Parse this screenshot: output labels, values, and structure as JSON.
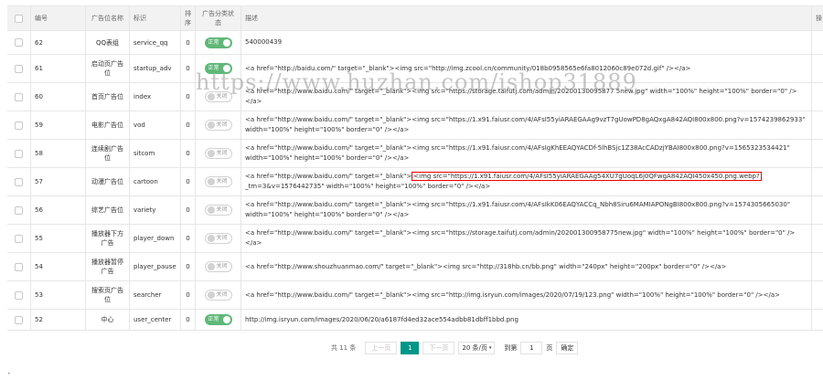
{
  "table": {
    "headers": {
      "id": "编号",
      "name": "广告位名称",
      "ident": "标识",
      "sort": "排序",
      "status": "广告分类状态",
      "desc": "描述",
      "last": "操"
    },
    "rows": [
      {
        "id": "62",
        "name": "QQ表组",
        "ident": "service_qq",
        "sort": "0",
        "status": "on",
        "status_label": "正常",
        "desc": "540000439"
      },
      {
        "id": "61",
        "name": "启动页广告位",
        "ident": "startup_adv",
        "sort": "0",
        "status": "on",
        "status_label": "正常",
        "desc": "<a href=\"http://baidu.com/\" target=\"_blank\"><img src=\"http://img.zcool.cn/community/018b0958565e6fa8012060c89e072d.gif\" /></a>"
      },
      {
        "id": "60",
        "name": "首页广告位",
        "ident": "index",
        "sort": "0",
        "status": "off",
        "status_label": "关闭",
        "desc": "<a href=\"http://www.baidu.com/\" target=\"_blank\"><img src=\"https://storage.taifutj.com/admin/20200130095877 5new.jpg\" width=\"100%\" height=\"100%\" border=\"0\" /></a>"
      },
      {
        "id": "59",
        "name": "电影广告位",
        "ident": "vod",
        "sort": "0",
        "status": "off",
        "status_label": "关闭",
        "desc": "<a href=\"http://www.baidu.com/\" target=\"_blank\"><img src=\"https://1.x91.faiusr.com/4/AFsI55yiARAEGAAg9vzT7gUowPD8gAQxgA842AQI800x800.png?v=1574239862933\" width=\"100%\" height=\"100%\" border=\"0\" /></a>"
      },
      {
        "id": "58",
        "name": "连续剧广告位",
        "ident": "sitcom",
        "sort": "0",
        "status": "off",
        "status_label": "关闭",
        "desc": "<a href=\"http://www.baidu.com/\" target=\"_blank\"><img src=\"https://1.x91.faiusr.com/4/AFsIgKhEEAQYACDf-5lhBSjc1Z38AcCADzjYBAI800x800.png?v=1565323534421\" width=\"100%\" height=\"100%\" border=\"0\" /></a>"
      },
      {
        "id": "57",
        "name": "动漫广告位",
        "ident": "cartoon",
        "sort": "0",
        "status": "off",
        "status_label": "关闭",
        "desc_pre": "<a href=\"http://www.baidu.com/\" target=\"_blank\">",
        "desc_hl": "<img src=\"https://1.x91.faiusr.com/4/AFsI55yiARAEGAAg54XU7gUoqL6j0QFwgA842AQI450x450.png.webp?",
        "desc_post": "_tm=3&v=1576442735\" width=\"100%\" height=\"100%\" border=\"0\" /></a>"
      },
      {
        "id": "56",
        "name": "综艺广告位",
        "ident": "variety",
        "sort": "0",
        "status": "off",
        "status_label": "关闭",
        "desc": "<a href=\"http://www.baidu.com/\" target=\"_blank\"><img src=\"https://1.x91.faiusr.com/4/AFsIkK06EAQYACCq_Nbh8Siru6MAMIAPONgBI800x800.png?v=1574305665030\" width=\"100%\" height=\"100%\" border=\"0\" /></a>"
      },
      {
        "id": "55",
        "name": "播放器下方广告",
        "ident": "player_down",
        "sort": "0",
        "status": "off",
        "status_label": "关闭",
        "desc": "<a href=\"http://www.baidu.com/\" target=\"_blank\"><img src=\"https://storage.taifutj.com/admin/202001300958775new.jpg\" width=\"100%\" height=\"100%\" border=\"0\" /></a>"
      },
      {
        "id": "54",
        "name": "播放器暂停广告",
        "ident": "player_pause",
        "sort": "0",
        "status": "off",
        "status_label": "关闭",
        "desc": "<a href=\"http://www.shouzhuanmao.com/\" target=\"_blank\"><img src=\"http://318hb.cn/bb.png\" width=\"240px\" height=\"200px\" border=\"0\" /></a>"
      },
      {
        "id": "53",
        "name": "搜索页广告位",
        "ident": "searcher",
        "sort": "0",
        "status": "off",
        "status_label": "关闭",
        "desc": "<a href=\"http://www.baidu.com/\" target=\"_blank\"><img src=\"http://img.isryun.com/images/2020/07/19/123.png\" width=\"100%\" height=\"100%\" border=\"0\" /></a>"
      },
      {
        "id": "52",
        "name": "中心",
        "ident": "user_center",
        "sort": "0",
        "status": "on",
        "status_label": "正常",
        "desc": "http://img.isryun.com/images/2020/06/20/a6187fd4ed32ace554adbb81dbff1bbd.png"
      }
    ]
  },
  "pager": {
    "total": "共 11 条",
    "prev": "上一页",
    "current": "1",
    "next": "下一页",
    "per_page": "20 条/页",
    "goto_label": "到第",
    "goto_value": "1",
    "page_unit": "页",
    "confirm": "确定"
  },
  "watermark": "https://www.huzhan.com/ishop31889",
  "colors": {
    "switch_on": "#5fb878",
    "pager_active": "#009688",
    "highlight_border": "#ee0000"
  }
}
